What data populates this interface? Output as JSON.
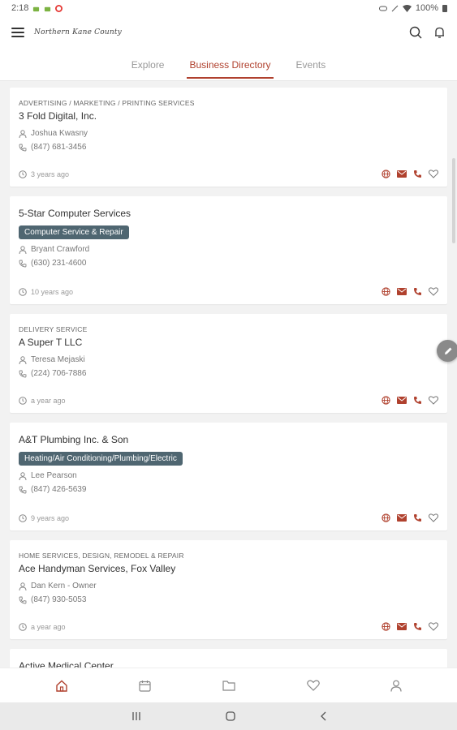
{
  "status_bar": {
    "time": "2:18",
    "battery": "100%"
  },
  "app": {
    "title": "Northern Kane County"
  },
  "tabs": [
    {
      "label": "Explore"
    },
    {
      "label": "Business Directory"
    },
    {
      "label": "Events"
    }
  ],
  "listings": [
    {
      "category": "ADVERTISING / MARKETING / PRINTING SERVICES",
      "name": "3 Fold Digital, Inc.",
      "badge": "",
      "contact": "Joshua Kwasny",
      "phone": "(847) 681-3456",
      "updated": "3 years ago"
    },
    {
      "category": "",
      "name": "5-Star Computer Services",
      "badge": "Computer Service & Repair",
      "contact": "Bryant Crawford",
      "phone": "(630) 231-4600",
      "updated": "10 years ago"
    },
    {
      "category": "DELIVERY SERVICE",
      "name": "A Super T LLC",
      "badge": "",
      "contact": "Teresa Mejaski",
      "phone": "(224) 706-7886",
      "updated": "a year ago"
    },
    {
      "category": "",
      "name": "A&T Plumbing Inc. & Son",
      "badge": "Heating/Air Conditioning/Plumbing/Electric",
      "contact": "Lee Pearson",
      "phone": "(847) 426-5639",
      "updated": "9 years ago"
    },
    {
      "category": "HOME SERVICES, DESIGN, REMODEL & REPAIR",
      "name": "Ace Handyman Services, Fox Valley",
      "badge": "",
      "contact": "Dan Kern - Owner",
      "phone": "(847) 930-5053",
      "updated": "a year ago"
    },
    {
      "category": "",
      "name": "Active Medical Center",
      "badge": "",
      "contact": "",
      "phone": "",
      "updated": ""
    }
  ],
  "colors": {
    "accent": "#b0412e",
    "badge_bg": "#4f6671"
  },
  "icons": {
    "card_actions": [
      "globe-icon",
      "email-icon",
      "phone-icon",
      "heart-icon"
    ],
    "bottom_nav": [
      "home-icon",
      "calendar-icon",
      "folder-icon",
      "heart-icon",
      "profile-icon"
    ]
  }
}
